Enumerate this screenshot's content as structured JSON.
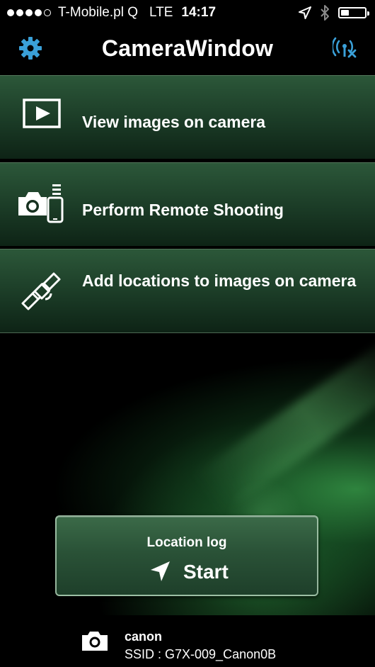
{
  "status_bar": {
    "signal_dots": 5,
    "signal_filled": 4,
    "carrier": "T-Mobile.pl Q",
    "network": "LTE",
    "time": "14:17",
    "battery_level": 0.35
  },
  "nav": {
    "title": "CameraWindow",
    "settings_icon": "gear-icon",
    "connection_icon": "wifi-disconnect-icon",
    "accent_color": "#3aa0d8"
  },
  "menu": {
    "items": [
      {
        "label": "View images on camera",
        "icon": "play-icon"
      },
      {
        "label": "Perform Remote Shooting",
        "icon": "remote-camera-icon"
      },
      {
        "label": "Add locations to images on camera",
        "icon": "satellite-icon"
      }
    ]
  },
  "location_log": {
    "title": "Location log",
    "action": "Start",
    "icon": "navigation-arrow-icon"
  },
  "camera": {
    "name": "canon",
    "ssid": "SSID : G7X-009_Canon0B",
    "icon": "camera-icon"
  }
}
